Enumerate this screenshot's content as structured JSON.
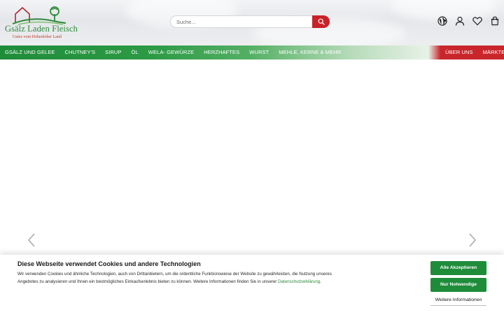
{
  "logo": {
    "title": "Gsälz Laden Fleisch",
    "subtitle": "Gutes vom Hohenloher Land"
  },
  "search": {
    "placeholder": "Suche...",
    "icon": "search-icon"
  },
  "header_icons": [
    "globe-icon",
    "user-icon",
    "heart-icon",
    "cart-icon"
  ],
  "nav": {
    "items": [
      "Gsälz und Gelee",
      "Chutney's",
      "Sirup",
      "Öl",
      "Wela- Gewürze",
      "Herzhaftes",
      "Wurst",
      "Mehle, Kerne & mehr"
    ],
    "right_items": [
      "Über uns",
      "Märkte"
    ]
  },
  "slider": {
    "prev_icon": "chevron-left-icon",
    "next_icon": "chevron-right-icon"
  },
  "cookie": {
    "title": "Diese Webseite verwendet Cookies und andere Technologien",
    "text": "Wir verwenden Cookies und ähnliche Technologien, auch von Drittanbietern, um die ordentliche Funktionsweise der Website zu gewährleisten, die Nutzung unseres Angebotes zu analysieren und Ihnen ein bestmögliches Einkaufserlebnis bieten zu können. Weitere Informationen finden Sie in unserer ",
    "link": "Datenschutzerklärung",
    "link_suffix": ".",
    "accept_all": "Alle Akzeptieren",
    "necessary_only": "Nur Notwendige",
    "more_info": "Weitere Informationen"
  },
  "colors": {
    "brand_green": "#1f8c3a",
    "brand_red": "#c9262b",
    "text": "#1a1a1a"
  }
}
